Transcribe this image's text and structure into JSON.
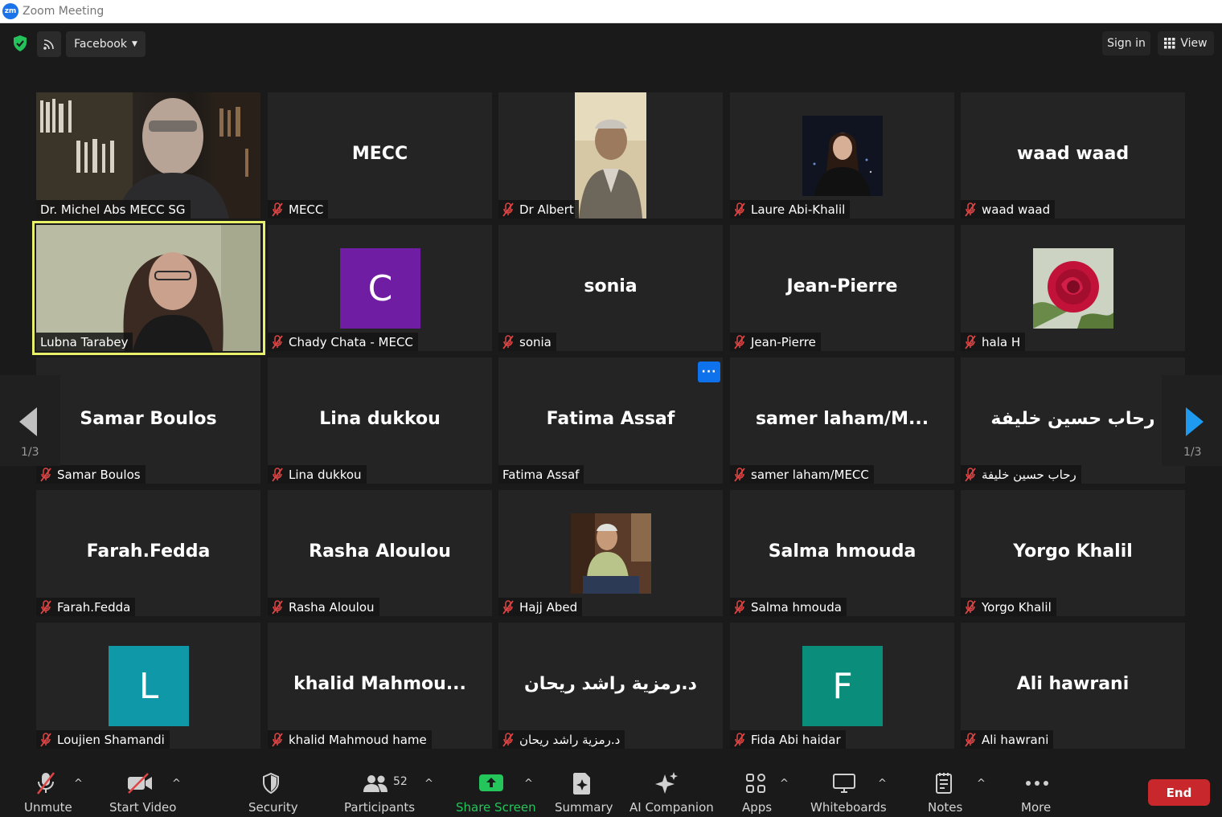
{
  "window": {
    "title": "Zoom Meeting",
    "logo_text": "zm"
  },
  "topbar": {
    "facebook_label": "Facebook",
    "signin_label": "Sign in",
    "view_label": "View"
  },
  "gallery": {
    "page_indicator_left": "1/3",
    "page_indicator_right": "1/3",
    "tiles": [
      {
        "name": "Dr. Michel Abs MECC SG",
        "big": "",
        "muted": false,
        "video": true
      },
      {
        "name": "MECC",
        "big": "MECC",
        "muted": true
      },
      {
        "name": "Dr Albert",
        "big": "",
        "muted": true,
        "video": true
      },
      {
        "name": "Laure Abi-Khalil",
        "big": "",
        "muted": true,
        "photo": true
      },
      {
        "name": "waad waad",
        "big": "waad waad",
        "muted": true
      },
      {
        "name": "Lubna Tarabey",
        "big": "",
        "muted": false,
        "video": true,
        "active_speaker": true
      },
      {
        "name": "Chady Chata - MECC",
        "big": "",
        "muted": true,
        "avatar_letter": "C",
        "avatar_color": "#6f1ea3"
      },
      {
        "name": "sonia",
        "big": "sonia",
        "muted": true
      },
      {
        "name": "Jean-Pierre",
        "big": "Jean-Pierre",
        "muted": true
      },
      {
        "name": "hala H",
        "big": "",
        "muted": true,
        "photo": true
      },
      {
        "name": "Samar Boulos",
        "big": "Samar Boulos",
        "muted": true
      },
      {
        "name": "Lina dukkou",
        "big": "Lina dukkou",
        "muted": true
      },
      {
        "name": "Fatima Assaf",
        "big": "Fatima Assaf",
        "muted": false
      },
      {
        "name": "samer laham/MECC",
        "big": "samer  laham/M...",
        "muted": true
      },
      {
        "name": "رحاب حسين خليفة",
        "big": "رحاب حسين خليفة",
        "muted": true
      },
      {
        "name": "Farah.Fedda",
        "big": "Farah.Fedda",
        "muted": true
      },
      {
        "name": "Rasha Aloulou",
        "big": "Rasha Aloulou",
        "muted": true
      },
      {
        "name": "Hajj Abed",
        "big": "",
        "muted": true,
        "photo": true
      },
      {
        "name": "Salma hmouda",
        "big": "Salma hmouda",
        "muted": true
      },
      {
        "name": "Yorgo Khalil",
        "big": "Yorgo Khalil",
        "muted": true
      },
      {
        "name": "Loujien Shamandi",
        "big": "",
        "muted": true,
        "avatar_letter": "L",
        "avatar_color": "#0e98a8"
      },
      {
        "name": "khalid Mahmoud hame",
        "big": "khalid  Mahmou...",
        "muted": true
      },
      {
        "name": "د.رمزية راشد ريحان",
        "big": "د.رمزية راشد ريحان",
        "muted": true
      },
      {
        "name": "Fida Abi haidar",
        "big": "",
        "muted": true,
        "avatar_letter": "F",
        "avatar_color": "#0a8d7b"
      },
      {
        "name": "Ali hawrani",
        "big": "Ali hawrani",
        "muted": true
      }
    ]
  },
  "toolbar": {
    "unmute": "Unmute",
    "start_video": "Start Video",
    "security": "Security",
    "participants": "Participants",
    "participants_count": "52",
    "share_screen": "Share Screen",
    "summary": "Summary",
    "ai_companion": "AI Companion",
    "apps": "Apps",
    "whiteboards": "Whiteboards",
    "notes": "Notes",
    "more": "More",
    "end": "End"
  },
  "colors": {
    "active_speaker_border": "#e9f06a",
    "share_green": "#24c55b",
    "end_red": "#c8282c",
    "accent_blue": "#0e72ed"
  }
}
